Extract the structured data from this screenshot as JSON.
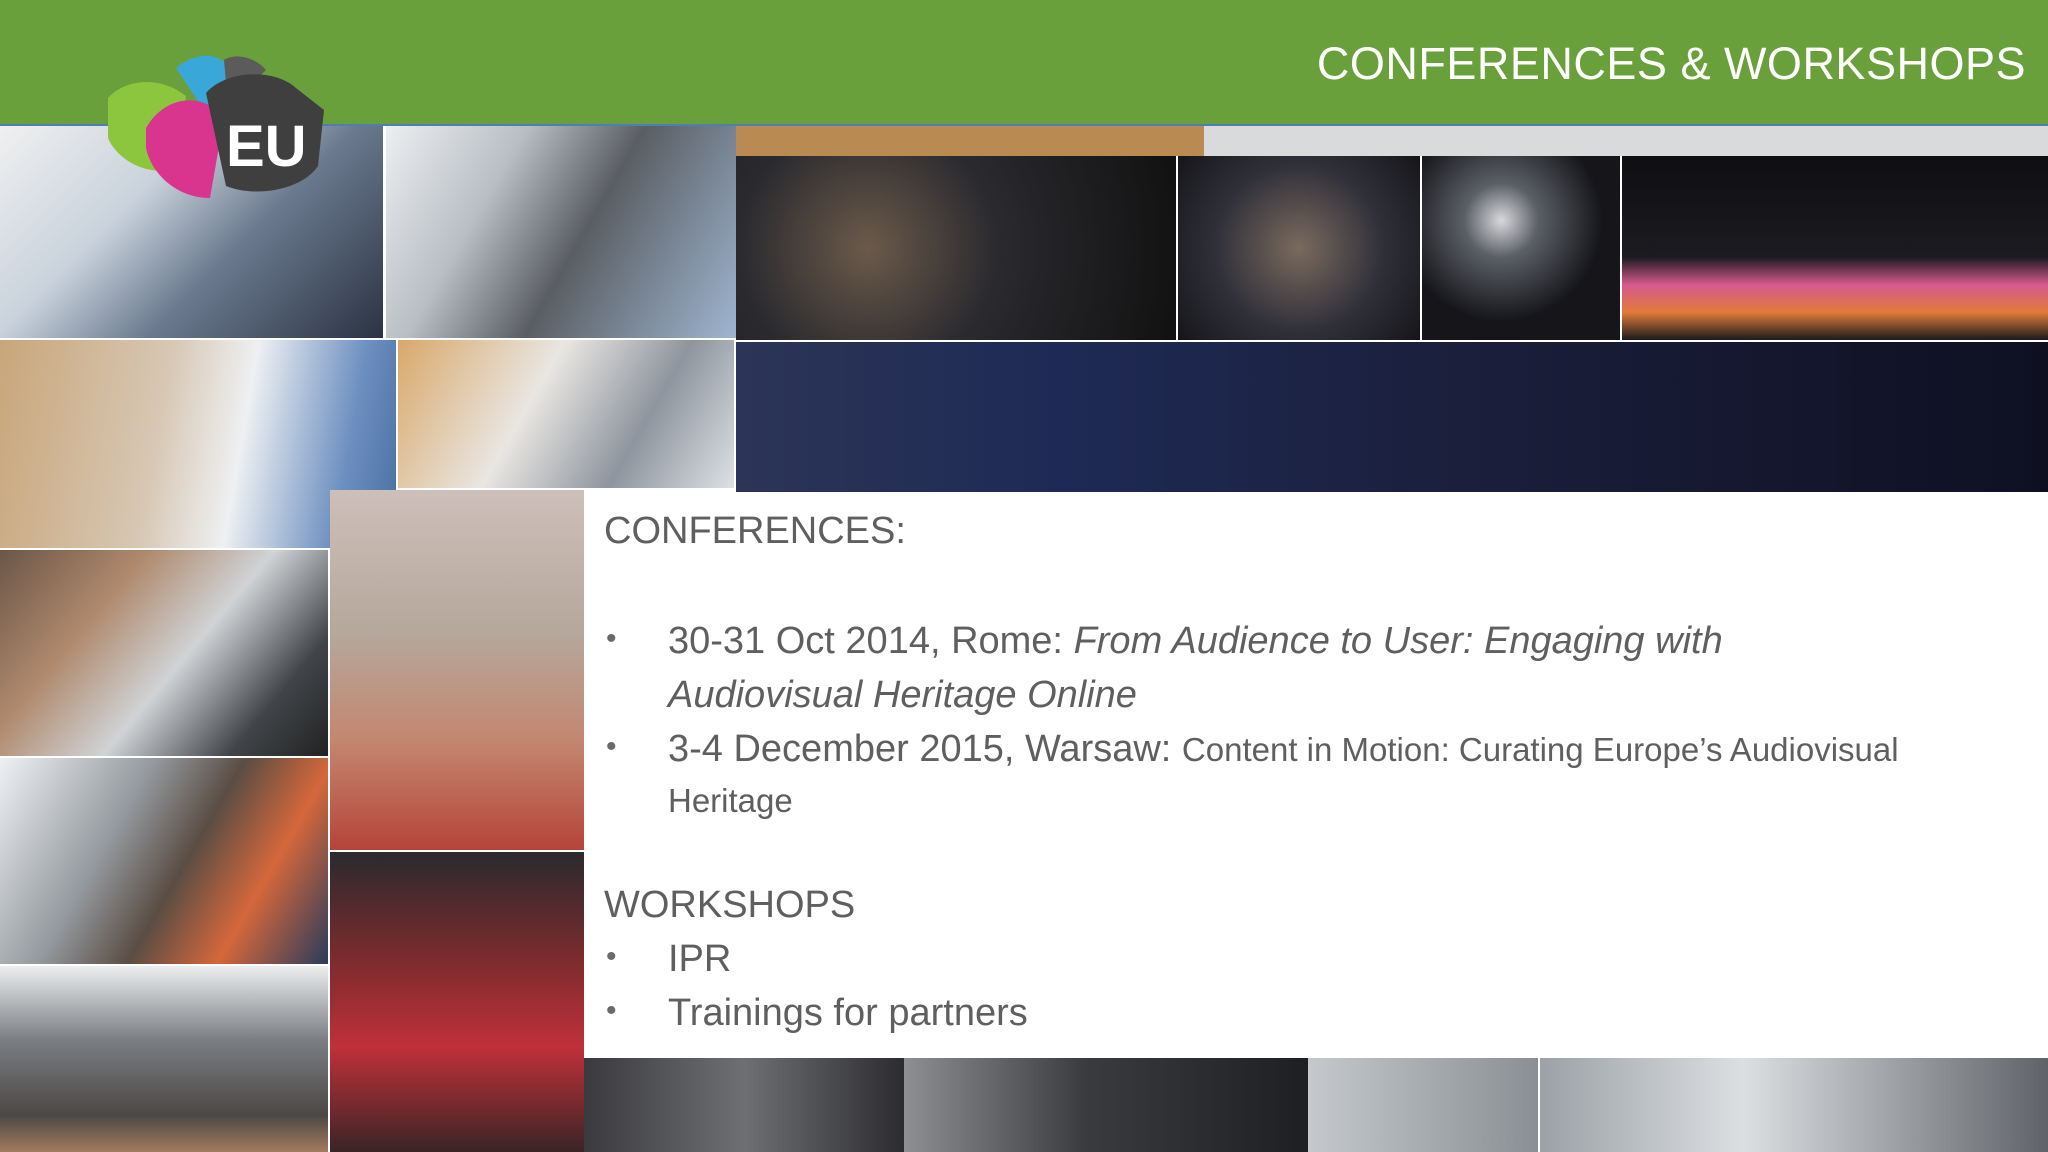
{
  "header": {
    "title": "CONFERENCES & WORKSHOPS",
    "background": "#6aa03c"
  },
  "logo": {
    "text": "EU"
  },
  "sections": {
    "conferences": {
      "heading": "CONFERENCES:",
      "items": [
        {
          "lead": "30-31 Oct 2014, Rome:  ",
          "title_line1": "From Audience to User: Engaging with",
          "title_line2": "Audiovisual Heritage Online"
        },
        {
          "lead": "3-4 December 2015, Warsaw: ",
          "title_line1": "Content in Motion: Curating Europe’s Audiovisual",
          "title_line2": "Heritage"
        }
      ]
    },
    "workshops": {
      "heading": "WORKSHOPS",
      "items": [
        "IPR",
        "Trainings for partners"
      ]
    }
  },
  "bullet_symbol": "•"
}
